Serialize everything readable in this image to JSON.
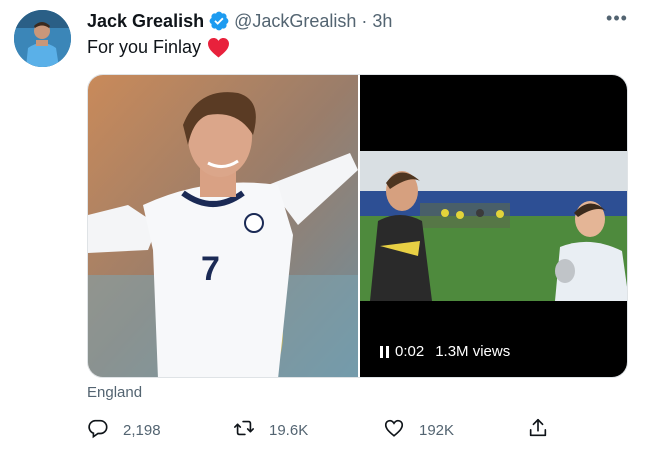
{
  "author": {
    "name": "Jack Grealish",
    "handle": "@JackGrealish",
    "separator": "·",
    "time": "3h",
    "verified": true,
    "verified_color": "#1d9bf0"
  },
  "tweet": {
    "text": "For you Finlay",
    "emoji": "heart-icon",
    "emoji_color": "#e8213c"
  },
  "media": {
    "photo_icon": "england-player-photo",
    "video": {
      "time": "0:02",
      "views": "1.3M views",
      "state": "playing"
    }
  },
  "location": "England",
  "actions": {
    "reply_count": "2,198",
    "retweet_count": "19.6K",
    "like_count": "192K"
  },
  "more_icon": "•••"
}
